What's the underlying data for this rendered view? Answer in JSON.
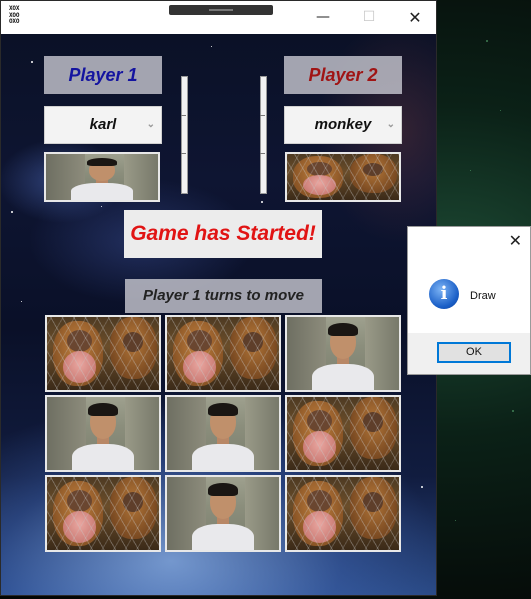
{
  "window": {
    "icon_text": [
      "XOX",
      "XOO",
      "OXO"
    ]
  },
  "players": {
    "p1": {
      "label": "Player 1",
      "label_color": "#1414a0",
      "name": "karl",
      "avatar": "boy"
    },
    "p2": {
      "label": "Player 2",
      "label_color": "#a01414",
      "name": "monkey",
      "avatar": "monkey"
    }
  },
  "status": {
    "headline": "Game has Started!",
    "headline_color": "#e11414",
    "turn": "Player 1 turns to move"
  },
  "board": [
    [
      "monkey",
      "monkey",
      "boy"
    ],
    [
      "boy",
      "boy",
      "monkey"
    ],
    [
      "monkey",
      "boy",
      "monkey"
    ]
  ],
  "dialog": {
    "message": "Draw",
    "ok_label": "OK"
  },
  "icons": {
    "close": "close-icon",
    "minimize": "minimize-icon",
    "maximize": "maximize-icon",
    "info": "info-icon",
    "dropdown": "chevron-down-icon"
  }
}
